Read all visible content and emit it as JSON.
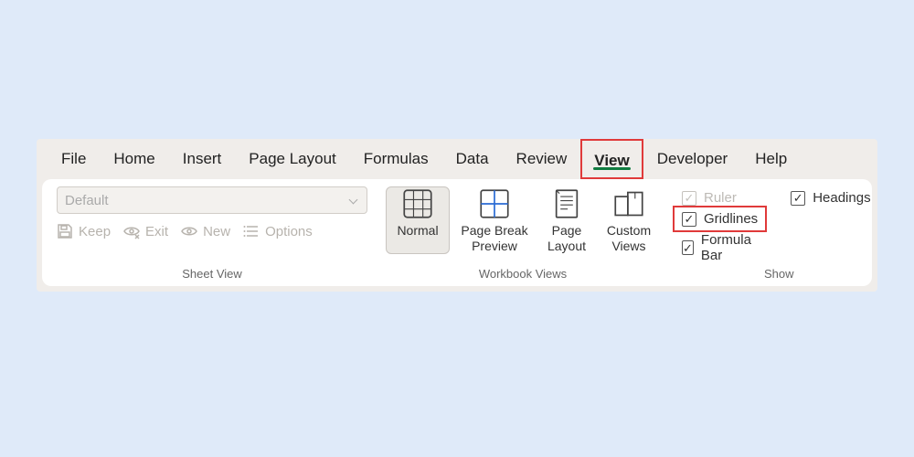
{
  "tabs": {
    "file": "File",
    "home": "Home",
    "insert": "Insert",
    "page_layout": "Page Layout",
    "formulas": "Formulas",
    "data": "Data",
    "review": "Review",
    "view": "View",
    "developer": "Developer",
    "help": "Help"
  },
  "sheet_view": {
    "group_label": "Sheet View",
    "selector_value": "Default",
    "keep": "Keep",
    "exit": "Exit",
    "new": "New",
    "options": "Options"
  },
  "workbook_views": {
    "group_label": "Workbook Views",
    "normal": "Normal",
    "page_break_l1": "Page Break",
    "page_break_l2": "Preview",
    "page_layout_l1": "Page",
    "page_layout_l2": "Layout",
    "custom_l1": "Custom",
    "custom_l2": "Views"
  },
  "show": {
    "group_label": "Show",
    "ruler": "Ruler",
    "gridlines": "Gridlines",
    "formula_bar": "Formula Bar",
    "headings": "Headings"
  },
  "colors": {
    "accent_green": "#107c41",
    "highlight_red": "#e03a3a",
    "bg": "#dfeaf9"
  }
}
